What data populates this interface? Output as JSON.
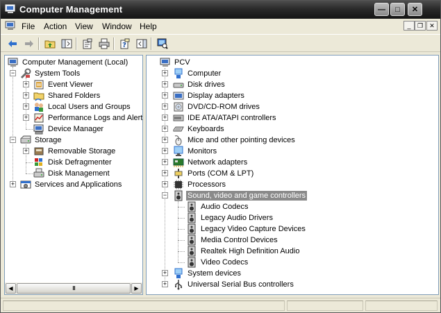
{
  "window": {
    "title": "Computer Management",
    "controls": {
      "minimize": "—",
      "maximize": "□",
      "close": "✕"
    }
  },
  "menubar": {
    "items": [
      "File",
      "Action",
      "View",
      "Window",
      "Help"
    ],
    "mdi_controls": {
      "minimize": "_",
      "restore": "❐",
      "close": "✕"
    }
  },
  "toolbar": {
    "buttons": [
      "back-arrow",
      "forward-arrow",
      "up-folder",
      "show-hide-tree",
      "properties",
      "print",
      "help",
      "show-hide-action-pane",
      "scan-hardware"
    ]
  },
  "left_tree": {
    "root": "Computer Management (Local)",
    "items": [
      {
        "label": "System Tools",
        "icon": "tools-icon",
        "level": 1,
        "expander": "-"
      },
      {
        "label": "Event Viewer",
        "icon": "event-viewer-icon",
        "level": 2,
        "expander": "+"
      },
      {
        "label": "Shared Folders",
        "icon": "shared-folder-icon",
        "level": 2,
        "expander": "+"
      },
      {
        "label": "Local Users and Groups",
        "icon": "users-icon",
        "level": 2,
        "expander": "+"
      },
      {
        "label": "Performance Logs and Alerts",
        "icon": "performance-icon",
        "level": 2,
        "expander": "+"
      },
      {
        "label": "Device Manager",
        "icon": "device-manager-icon",
        "level": 2,
        "expander": ""
      },
      {
        "label": "Storage",
        "icon": "storage-icon",
        "level": 1,
        "expander": "-"
      },
      {
        "label": "Removable Storage",
        "icon": "removable-storage-icon",
        "level": 2,
        "expander": "+"
      },
      {
        "label": "Disk Defragmenter",
        "icon": "defrag-icon",
        "level": 2,
        "expander": ""
      },
      {
        "label": "Disk Management",
        "icon": "disk-management-icon",
        "level": 2,
        "expander": ""
      },
      {
        "label": "Services and Applications",
        "icon": "services-icon",
        "level": 1,
        "expander": "+"
      }
    ],
    "scrollbar": {
      "left": "◀",
      "thumb": "III",
      "right": "▶"
    }
  },
  "right_tree": {
    "root": "PCV",
    "items": [
      {
        "label": "Computer",
        "icon": "computer-icon",
        "expander": "+"
      },
      {
        "label": "Disk drives",
        "icon": "disk-drive-icon",
        "expander": "+"
      },
      {
        "label": "Display adapters",
        "icon": "display-adapter-icon",
        "expander": "+"
      },
      {
        "label": "DVD/CD-ROM drives",
        "icon": "cdrom-icon",
        "expander": "+"
      },
      {
        "label": "IDE ATA/ATAPI controllers",
        "icon": "ide-controller-icon",
        "expander": "+"
      },
      {
        "label": "Keyboards",
        "icon": "keyboard-icon",
        "expander": "+"
      },
      {
        "label": "Mice and other pointing devices",
        "icon": "mouse-icon",
        "expander": "+"
      },
      {
        "label": "Monitors",
        "icon": "monitor-icon",
        "expander": "+"
      },
      {
        "label": "Network adapters",
        "icon": "network-adapter-icon",
        "expander": "+"
      },
      {
        "label": "Ports (COM & LPT)",
        "icon": "port-icon",
        "expander": "+"
      },
      {
        "label": "Processors",
        "icon": "processor-icon",
        "expander": "+"
      },
      {
        "label": "Sound, video and game controllers",
        "icon": "speaker-icon",
        "expander": "-",
        "selected": true,
        "children": [
          "Audio Codecs",
          "Legacy Audio Drivers",
          "Legacy Video Capture Devices",
          "Media Control Devices",
          "Realtek High Definition Audio",
          "Video Codecs"
        ]
      },
      {
        "label": "System devices",
        "icon": "system-device-icon",
        "expander": "+"
      },
      {
        "label": "Universal Serial Bus controllers",
        "icon": "usb-icon",
        "expander": "+"
      }
    ]
  }
}
